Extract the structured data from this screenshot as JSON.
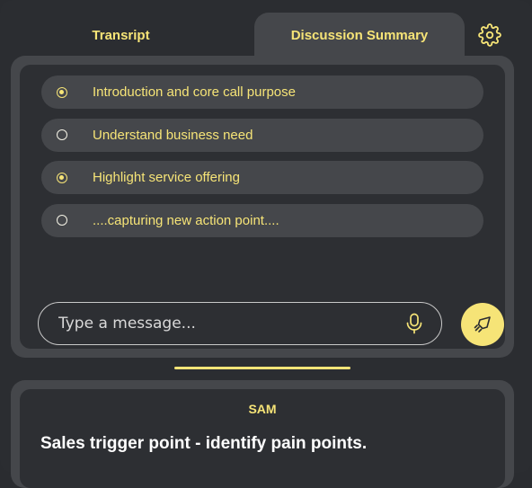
{
  "tabs": {
    "transcript": "Transript",
    "summary": "Discussion Summary"
  },
  "settings": {
    "icon": "gear-icon"
  },
  "checklist": [
    {
      "label": "Introduction and core call purpose",
      "checked": true
    },
    {
      "label": "Understand business need",
      "checked": false
    },
    {
      "label": "Highlight service offering",
      "checked": true
    },
    {
      "label": "....capturing new action point....",
      "checked": false
    }
  ],
  "input": {
    "placeholder": "Type a message...",
    "mic_icon": "microphone-icon",
    "send_icon": "send-icon"
  },
  "card": {
    "title": "SAM",
    "text": "Sales trigger point - identify pain points."
  },
  "colors": {
    "accent": "#f6e477",
    "background": "#2b2d31",
    "panel": "#45474b",
    "inner": "#2d2f33"
  }
}
